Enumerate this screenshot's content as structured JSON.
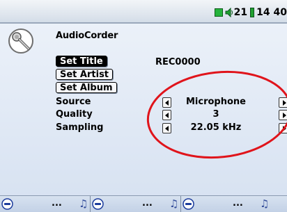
{
  "statusbar": {
    "volume": "21",
    "time": "14 40"
  },
  "app": {
    "title": "AudioCorder"
  },
  "buttons": {
    "set_title": "Set Title",
    "set_artist": "Set Artist",
    "set_album": "Set Album"
  },
  "recording_title": "REC0000",
  "params": [
    {
      "label": "Source",
      "value": "Microphone"
    },
    {
      "label": "Quality",
      "value": "3"
    },
    {
      "label": "Sampling",
      "value": "22.05 kHz"
    }
  ],
  "bottom_slots": [
    {
      "dots": "..."
    },
    {
      "dots": "..."
    },
    {
      "dots": "..."
    }
  ],
  "colors": {
    "annotation_ellipse": "#e0141b",
    "battery": "#20a030",
    "indicator": "#25b33c"
  }
}
